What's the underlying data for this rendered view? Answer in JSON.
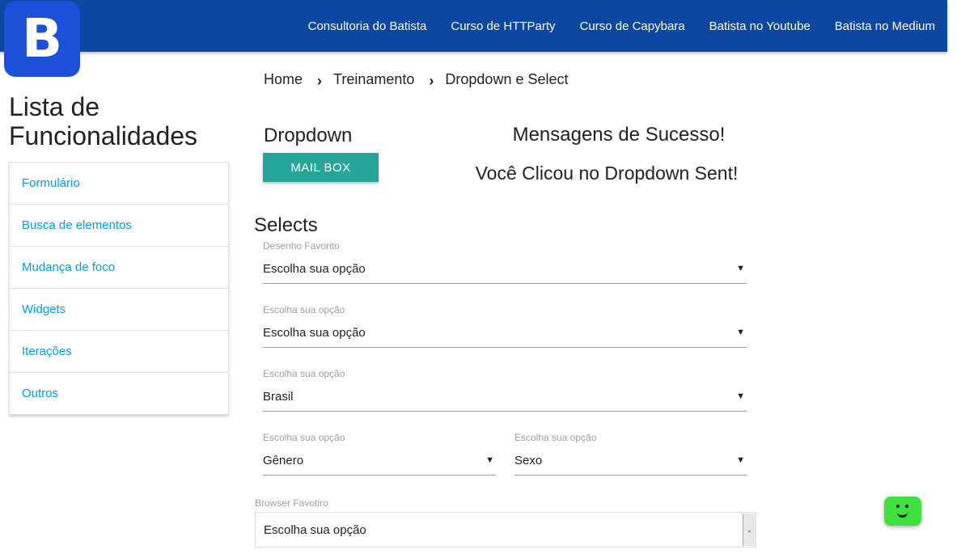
{
  "logo": {
    "letter": "B"
  },
  "nav": {
    "links": [
      "Consultoria do Batista",
      "Curso de HTTParty",
      "Curso de Capybara",
      "Batista no Youtube",
      "Batista no Medium"
    ]
  },
  "sidebar": {
    "title_line1": "Lista de",
    "title_line2": "Funcionalidades",
    "items": [
      "Formulário",
      "Busca de elementos",
      "Mudança de foco",
      "Widgets",
      "Iterações",
      "Outros"
    ]
  },
  "breadcrumb": {
    "items": [
      "Home",
      "Treinamento",
      "Dropdown e Select"
    ],
    "separator": "›"
  },
  "dropdown": {
    "heading": "Dropdown",
    "button_label": "MAIL BOX"
  },
  "messages": {
    "title": "Mensagens de Sucesso!",
    "text": "Você Clicou no Dropdown Sent!"
  },
  "selects": {
    "heading": "Selects",
    "fields": [
      {
        "label": "Desenho Favorito",
        "value": "Escolha sua opção"
      },
      {
        "label": "Escolha sua opção",
        "value": "Escolha sua opção"
      },
      {
        "label": "Escolha sua opção",
        "value": "Brasil"
      },
      {
        "label": "Escolha sua opção",
        "value": "Gênero"
      },
      {
        "label": "Escolha sua opção",
        "value": "Sexo"
      }
    ],
    "browser": {
      "label": "Browser Favotiro",
      "value": "Escolha sua opção"
    }
  },
  "icons": {
    "dropdown_arrow": "▼",
    "native_select_arrow": "⌄"
  },
  "colors": {
    "navbar": "#0d47a1",
    "logo": "#1e4fd8",
    "button": "#26a69a",
    "link": "#039be5",
    "chat": "#40e040"
  }
}
